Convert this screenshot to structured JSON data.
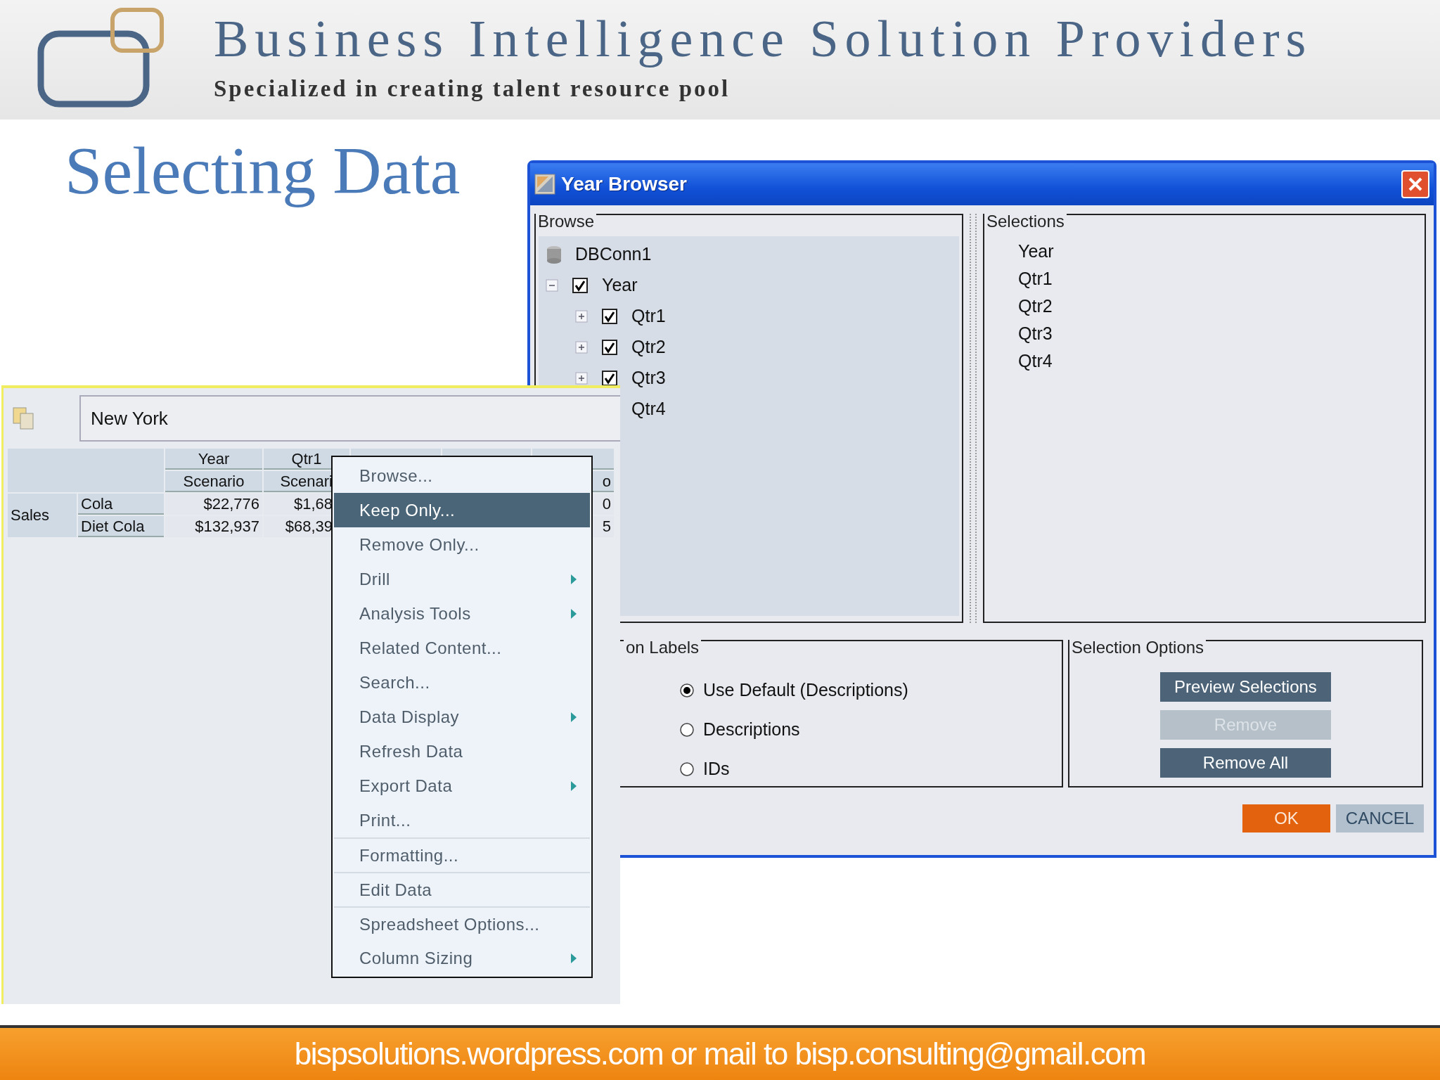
{
  "header": {
    "title": "Business Intelligence Solution Providers",
    "tagline": "Specialized in creating talent resource pool"
  },
  "slide_title": "Selecting Data",
  "dialog": {
    "title": "Year Browser",
    "browse": {
      "legend": "Browse",
      "tree": [
        {
          "label": "DBConn1",
          "kind": "connection",
          "children": [
            {
              "label": "Year",
              "kind": "member",
              "expanded": true,
              "checked": true,
              "children": [
                {
                  "label": "Qtr1",
                  "kind": "member",
                  "expanded": false,
                  "checked": true
                },
                {
                  "label": "Qtr2",
                  "kind": "member",
                  "expanded": false,
                  "checked": true
                },
                {
                  "label": "Qtr3",
                  "kind": "member",
                  "expanded": false,
                  "checked": true
                },
                {
                  "label": "Qtr4",
                  "kind": "member"
                }
              ]
            }
          ]
        }
      ]
    },
    "selections": {
      "legend": "Selections",
      "items": [
        "Year",
        "Qtr1",
        "Qtr2",
        "Qtr3",
        "Qtr4"
      ]
    },
    "labels_group": {
      "legend": "on Labels",
      "options": [
        {
          "label": "Use Default (Descriptions)",
          "selected": true
        },
        {
          "label": "Descriptions",
          "selected": false
        },
        {
          "label": "IDs",
          "selected": false
        }
      ]
    },
    "selection_options": {
      "legend": "Selection Options",
      "buttons": [
        {
          "label": "Preview Selections",
          "disabled": false
        },
        {
          "label": "Remove",
          "disabled": true
        },
        {
          "label": "Remove All",
          "disabled": false
        }
      ]
    },
    "buttons": [
      {
        "label": "OK",
        "kind": "primary"
      },
      {
        "label": "CANCEL",
        "kind": "secondary"
      }
    ]
  },
  "spreadsheet": {
    "pov": "New York",
    "columns": [
      {
        "top": "Year",
        "bottom": "Scenario"
      },
      {
        "top": "Qtr1",
        "bottom": "Scenari"
      }
    ],
    "edge_column": {
      "bottom": "o"
    },
    "row_group": "Sales",
    "rows": [
      {
        "label": "Cola",
        "values": [
          "$22,776",
          "$1,68"
        ],
        "edge_value": "0"
      },
      {
        "label": "Diet Cola",
        "values": [
          "$132,937",
          "$68,39"
        ],
        "edge_value": "5"
      }
    ]
  },
  "context_menu": [
    {
      "label": "Browse...",
      "selected": false,
      "submenu": false,
      "divider_above": false
    },
    {
      "label": "Keep Only...",
      "selected": true,
      "submenu": false,
      "divider_above": false
    },
    {
      "label": "Remove Only...",
      "selected": false,
      "submenu": false,
      "divider_above": false
    },
    {
      "label": "Drill",
      "selected": false,
      "submenu": true,
      "divider_above": false
    },
    {
      "label": "Analysis Tools",
      "selected": false,
      "submenu": true,
      "divider_above": false
    },
    {
      "label": "Related Content...",
      "selected": false,
      "submenu": false,
      "divider_above": false
    },
    {
      "label": "Search...",
      "selected": false,
      "submenu": false,
      "divider_above": false
    },
    {
      "label": "Data Display",
      "selected": false,
      "submenu": true,
      "divider_above": false
    },
    {
      "label": "Refresh Data",
      "selected": false,
      "submenu": false,
      "divider_above": false
    },
    {
      "label": "Export Data",
      "selected": false,
      "submenu": true,
      "divider_above": false
    },
    {
      "label": "Print...",
      "selected": false,
      "submenu": false,
      "divider_above": false
    },
    {
      "label": "Formatting...",
      "selected": false,
      "submenu": false,
      "divider_above": true
    },
    {
      "label": "Edit Data",
      "selected": false,
      "submenu": false,
      "divider_above": true
    },
    {
      "label": "Spreadsheet Options...",
      "selected": false,
      "submenu": false,
      "divider_above": true
    },
    {
      "label": "Column Sizing",
      "selected": false,
      "submenu": true,
      "divider_above": false
    }
  ],
  "footer": "bispsolutions.wordpress.com or mail to bisp.consulting@gmail.com"
}
